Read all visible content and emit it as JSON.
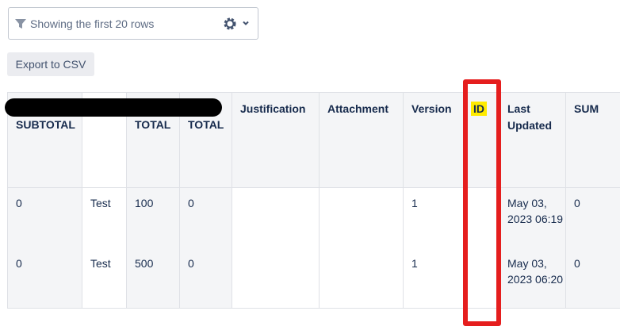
{
  "filter": {
    "label": "Showing the first 20 rows",
    "icons": [
      "filter-icon",
      "gear-icon",
      "chevron-down-icon"
    ]
  },
  "export_button": {
    "label": "Export to CSV"
  },
  "table": {
    "headers": [
      "SUBTOTAL",
      "",
      "TOTAL",
      "TOTAL",
      "Justification",
      "Attachment",
      "Version",
      "ID",
      "Last Updated",
      "SUM"
    ],
    "rows": [
      [
        "0",
        "Test",
        "100",
        "0",
        "",
        "",
        "1",
        "",
        "May 03, 2023 06:19",
        "0"
      ],
      [
        "0",
        "Test",
        "500",
        "0",
        "",
        "",
        "1",
        "",
        "May 03, 2023 06:20",
        "0"
      ]
    ]
  },
  "colors": {
    "id_highlight": "#ffeb00",
    "annotation_frame": "#e51e1e",
    "header_bg": "#f4f5f7",
    "redaction": "#000000"
  }
}
